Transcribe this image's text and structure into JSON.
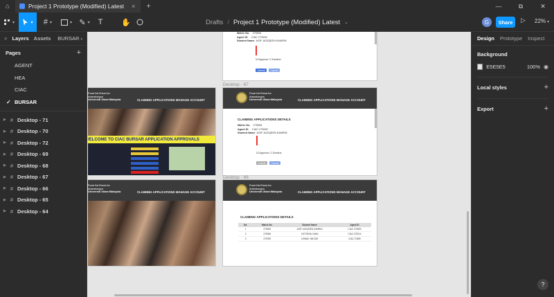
{
  "titlebar": {
    "tab_title": "Project 1 Prototype (Modified) Latest",
    "tab_close": "×",
    "new_tab": "+",
    "home_icon": "home-icon",
    "window_controls": [
      "—",
      "⧉",
      "✕"
    ]
  },
  "toolbar": {
    "breadcrumb_root": "Drafts",
    "breadcrumb_sep": "/",
    "file_name": "Project 1 Prototype (Modified) Latest",
    "file_menu_caret": "⌄",
    "avatar_initial": "G",
    "share_label": "Share",
    "zoom_value": "22%",
    "tools": [
      "main-menu",
      "move",
      "frame",
      "shape",
      "pen",
      "text",
      "hand",
      "comment"
    ]
  },
  "left_panel": {
    "tabs": [
      "Layers",
      "Assets"
    ],
    "current_page_selector": "BURSAR",
    "pages_title": "Pages",
    "pages": [
      "AGENT",
      "HEA",
      "CIAC",
      "BURSAR"
    ],
    "selected_page": "BURSAR",
    "layers": [
      "Desktop - 71",
      "Desktop - 70",
      "Desktop - 72",
      "Desktop - 69",
      "Desktop - 68",
      "Desktop - 67",
      "Desktop - 66",
      "Desktop - 65",
      "Desktop - 64"
    ]
  },
  "right_panel": {
    "tabs": [
      "Design",
      "Prototype",
      "Inspect"
    ],
    "active_tab": "Design",
    "background_title": "Background",
    "background_color": "#E5E5E5",
    "background_hex": "E5E5E5",
    "background_opacity": "100%",
    "local_styles": "Local styles",
    "export": "Export",
    "help": "?"
  },
  "canvas": {
    "background": "#e5e5e5",
    "frame_labels": [
      "Desktop - 67",
      "Desktop - 66"
    ],
    "nav": {
      "claiming": "CLAIMING APPLICATIONS",
      "manage": "MANAGE ACCOUNT"
    },
    "university": {
      "line1": "Pusat Hal Ehwal Am",
      "line2": "Antarabangsa",
      "name": "Universiti Utara Malaysia"
    },
    "welcome_banner": "WELCOME TO CIAC BURSAR APPLICATION APPROVALS",
    "form": {
      "title": "CLAIMING APPLICATIONS DETAILS",
      "matric_label": "Matric No.",
      "matric_value": "275906",
      "agent_label": "Agent ID",
      "agent_value": "CIAC 273590",
      "student_label": "Student Name",
      "student_value": "ASIF JAZIQEEN KAMRIN",
      "approve": "Approve",
      "decline": "Decline",
      "submit": "Submit",
      "cancel": "Cancel"
    },
    "list": {
      "title": "CLAIMING APPLICATIONS DETAILS",
      "columns": [
        "No.",
        "Matric No.",
        "Student Name",
        "Agent ID"
      ],
      "rows": [
        [
          "1",
          "275906",
          "ASIF JAZIQEEN KAMRIN",
          "CIAC 273590"
        ],
        [
          "2",
          "275908",
          "VICTORIA CHAN",
          "CIAC 275214"
        ],
        [
          "3",
          "275789",
          "LEWAH JIM DIM",
          "CIAC 27689"
        ]
      ]
    },
    "accent_button": "#3d6fd8",
    "banner_color": "#f2ea3a"
  }
}
